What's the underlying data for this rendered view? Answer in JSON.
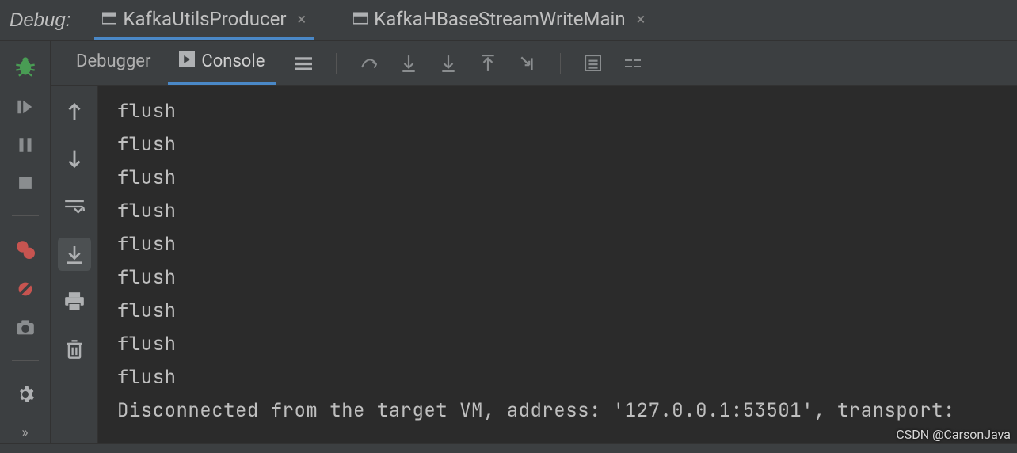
{
  "debug_label": "Debug:",
  "tabs": [
    {
      "label": "KafkaUtilsProducer",
      "active": true
    },
    {
      "label": "KafkaHBaseStreamWriteMain",
      "active": false
    }
  ],
  "subtabs": {
    "debugger": "Debugger",
    "console": "Console"
  },
  "console_lines": [
    "flush",
    "flush",
    "flush",
    "flush",
    "flush",
    "flush",
    "flush",
    "flush",
    "flush",
    "Disconnected from the target VM, address: '127.0.0.1:53501', transport:"
  ],
  "watermark": "CSDN @CarsonJava"
}
